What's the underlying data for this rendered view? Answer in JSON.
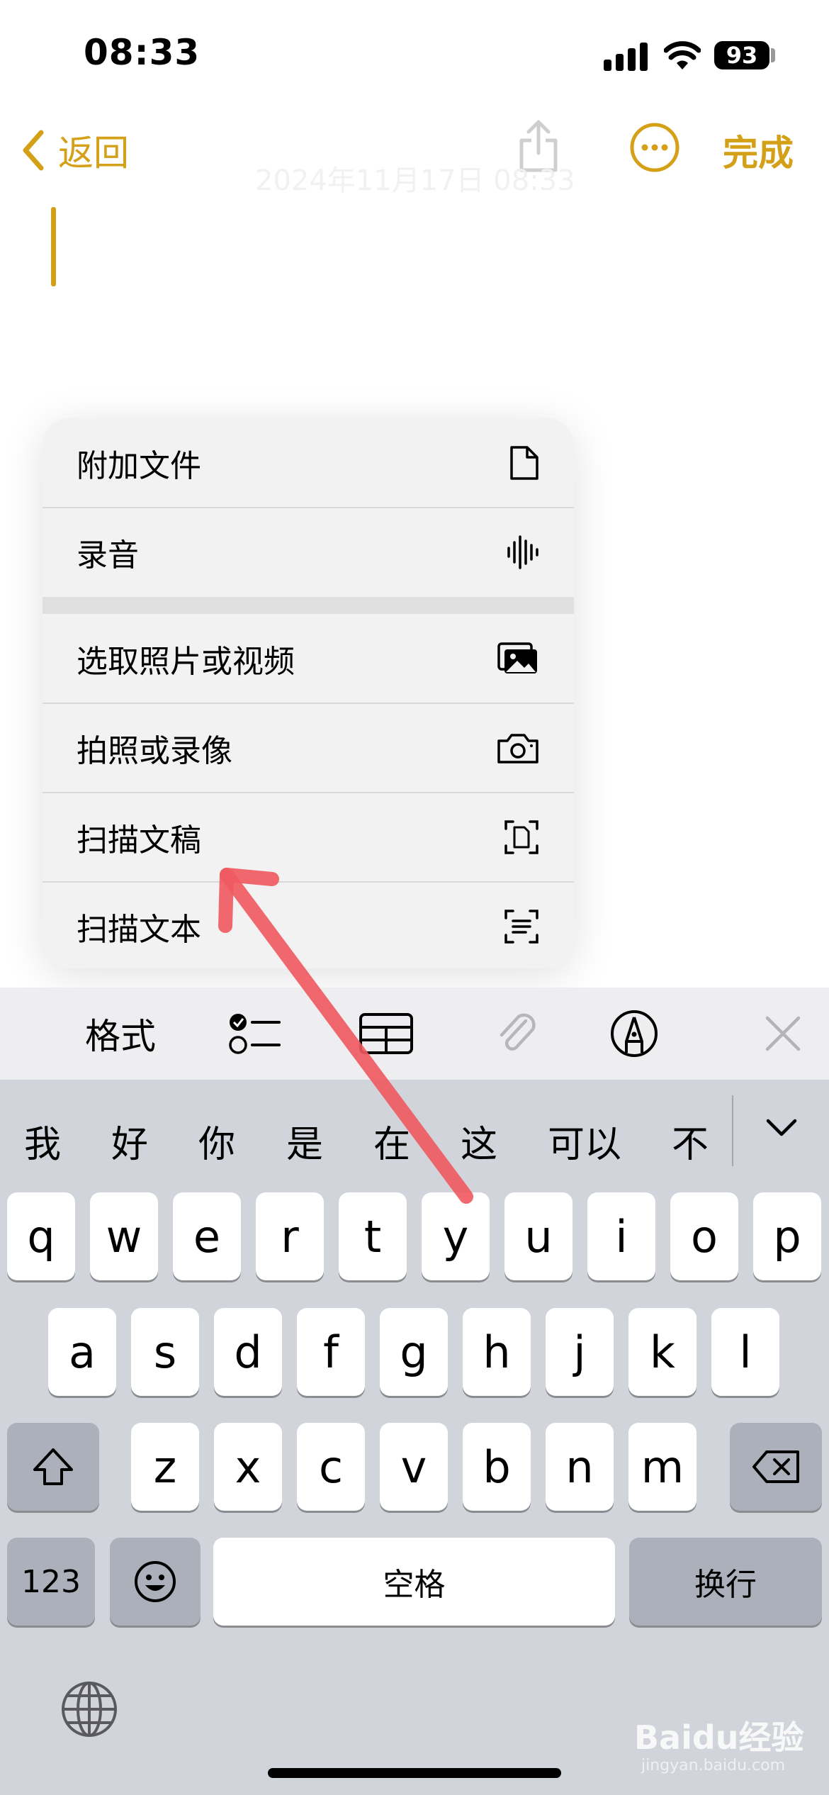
{
  "status_bar": {
    "time": "08:33",
    "battery": "93"
  },
  "nav": {
    "back_label": "返回",
    "done_label": "完成"
  },
  "note": {
    "faint_date": "2024年11月17日 08:33"
  },
  "menu": {
    "items": [
      {
        "label": "附加文件",
        "icon": "document-icon"
      },
      {
        "label": "录音",
        "icon": "waveform-icon"
      },
      {
        "label": "选取照片或视频",
        "icon": "photo-library-icon"
      },
      {
        "label": "拍照或录像",
        "icon": "camera-icon"
      },
      {
        "label": "扫描文稿",
        "icon": "scan-document-icon"
      },
      {
        "label": "扫描文本",
        "icon": "scan-text-icon"
      }
    ]
  },
  "toolbar": {
    "format_label": "格式"
  },
  "keyboard": {
    "candidates": [
      "我",
      "好",
      "你",
      "是",
      "在",
      "这",
      "可以",
      "不"
    ],
    "row1": [
      "q",
      "w",
      "e",
      "r",
      "t",
      "y",
      "u",
      "i",
      "o",
      "p"
    ],
    "row2": [
      "a",
      "s",
      "d",
      "f",
      "g",
      "h",
      "j",
      "k",
      "l"
    ],
    "row3": [
      "z",
      "x",
      "c",
      "v",
      "b",
      "n",
      "m"
    ],
    "numbers_label": "123",
    "space_label": "空格",
    "return_label": "换行"
  },
  "watermark": {
    "brand": "Baidu经验",
    "url": "jingyan.baidu.com"
  },
  "colors": {
    "accent": "#d4a017",
    "arrow": "#f0595f",
    "keyboard_bg": "#d1d4db"
  }
}
